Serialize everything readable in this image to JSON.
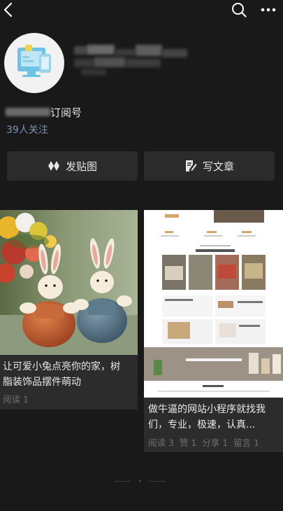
{
  "profile": {
    "name_suffix": "订阅号",
    "follow_count": "39人关注"
  },
  "actions": {
    "post_label": "发贴图",
    "write_label": "写文章"
  },
  "cards": [
    {
      "title_line1": "让可爱小兔点亮你的家，树",
      "title_line2": "脂装饰品摆件萌动",
      "meta": "阅读 1"
    },
    {
      "title_line1": "做牛逼的网站小程序就找我",
      "title_line2": "们，专业，极速，认真...",
      "meta": "阅读 3  赞 1  分享 1  留言 1"
    }
  ],
  "colors": {
    "background": "#191919",
    "card": "#2c2c2c",
    "button": "#2b2b2b",
    "accent_link": "#7d92b6",
    "meta_text": "#6f6f6f"
  },
  "icons": [
    "back-icon",
    "search-icon",
    "more-icon",
    "post-image-icon",
    "write-article-icon"
  ]
}
